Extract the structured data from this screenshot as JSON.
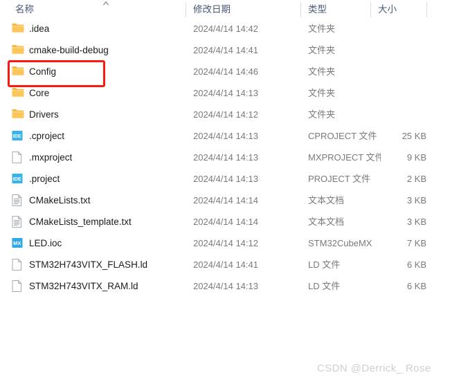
{
  "window": {
    "kind": "file-explorer-details-view",
    "background": "#ffffff"
  },
  "header": {
    "columns": [
      {
        "key": "name",
        "label": "名称",
        "sorted": true,
        "sort_direction": "ascending"
      },
      {
        "key": "date",
        "label": "修改日期",
        "sorted": false,
        "sort_direction": ""
      },
      {
        "key": "type",
        "label": "类型",
        "sorted": false,
        "sort_direction": ""
      },
      {
        "key": "size",
        "label": "大小",
        "sorted": false,
        "sort_direction": ""
      }
    ]
  },
  "files": [
    {
      "name": ".idea",
      "date": "2024/4/14 14:42",
      "type": "文件夹",
      "size": "",
      "icon": "folder-icon"
    },
    {
      "name": "cmake-build-debug",
      "date": "2024/4/14 14:41",
      "type": "文件夹",
      "size": "",
      "icon": "folder-icon"
    },
    {
      "name": "Config",
      "date": "2024/4/14 14:46",
      "type": "文件夹",
      "size": "",
      "icon": "folder-icon"
    },
    {
      "name": "Core",
      "date": "2024/4/14 14:13",
      "type": "文件夹",
      "size": "",
      "icon": "folder-icon"
    },
    {
      "name": "Drivers",
      "date": "2024/4/14 14:12",
      "type": "文件夹",
      "size": "",
      "icon": "folder-icon"
    },
    {
      "name": ".cproject",
      "date": "2024/4/14 14:13",
      "type": "CPROJECT 文件",
      "size": "25 KB",
      "icon": "ide-file-icon"
    },
    {
      "name": ".mxproject",
      "date": "2024/4/14 14:13",
      "type": "MXPROJECT 文件",
      "size": "9 KB",
      "icon": "blank-file-icon"
    },
    {
      "name": ".project",
      "date": "2024/4/14 14:13",
      "type": "PROJECT 文件",
      "size": "2 KB",
      "icon": "ide-file-icon"
    },
    {
      "name": "CMakeLists.txt",
      "date": "2024/4/14 14:14",
      "type": "文本文档",
      "size": "3 KB",
      "icon": "text-file-icon"
    },
    {
      "name": "CMakeLists_template.txt",
      "date": "2024/4/14 14:14",
      "type": "文本文档",
      "size": "3 KB",
      "icon": "text-file-icon"
    },
    {
      "name": "LED.ioc",
      "date": "2024/4/14 14:12",
      "type": "STM32CubeMX",
      "size": "7 KB",
      "icon": "cubemx-file-icon"
    },
    {
      "name": "STM32H743VITX_FLASH.ld",
      "date": "2024/4/14 14:41",
      "type": "LD 文件",
      "size": "6 KB",
      "icon": "blank-file-icon"
    },
    {
      "name": "STM32H743VITX_RAM.ld",
      "date": "2024/4/14 14:13",
      "type": "LD 文件",
      "size": "6 KB",
      "icon": "blank-file-icon"
    }
  ],
  "annotation": {
    "target_row_name": "Config",
    "color": "#f81a0c",
    "shape": "rectangle"
  },
  "watermark": {
    "text": "CSDN @Derrick_ Rose",
    "color": "#cfcfcf"
  },
  "colors": {
    "folder_yellow": "#fcc75a",
    "folder_yellow_dark": "#f5b940",
    "ide_blue": "#35b4ec",
    "cubemx_blue": "#2fa8e8",
    "header_text": "#4a5a78",
    "row_text": "#1b1b1b",
    "meta_text": "#7a7a7a",
    "divider": "#dcdcdc"
  }
}
